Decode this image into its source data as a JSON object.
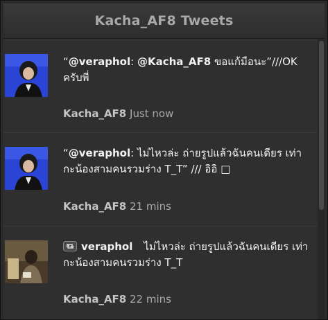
{
  "header": {
    "title": "Kacha_AF8 Tweets"
  },
  "tweets": [
    {
      "text_parts": [
        "“",
        "@veraphol",
        ": ",
        "@Kacha_AF8",
        " ขอแก้มือนะ”///OK ครับพี่"
      ],
      "user": "Kacha_AF8",
      "time": "Just now",
      "avatar": "profile-photo-blue"
    },
    {
      "text_parts": [
        "“",
        "@veraphol",
        ": ไม่ไหวล่ะ ถ่ายรูปแล้วฉันคนเดียร เท่ากะน้องสามคนรวมร่าง T_T” /// อิอิ □"
      ],
      "user": "Kacha_AF8",
      "time": "21 mins",
      "avatar": "profile-photo-blue"
    },
    {
      "retweet_icon": "retweet-icon",
      "retweet_user": "veraphol",
      "text": "ไม่ไหวล่ะ ถ่ายรูปแล้วฉันคนเดียร เท่ากะน้องสามคนรวมร่าง T_T",
      "user": "Kacha_AF8",
      "time": "22 mins",
      "avatar": "photo-group"
    }
  ],
  "colors": {
    "background": "#2f2f2f",
    "header_text": "#a9a9a9",
    "meta_text": "#a8a8a8",
    "avatar_bg": "#2a45d6"
  }
}
